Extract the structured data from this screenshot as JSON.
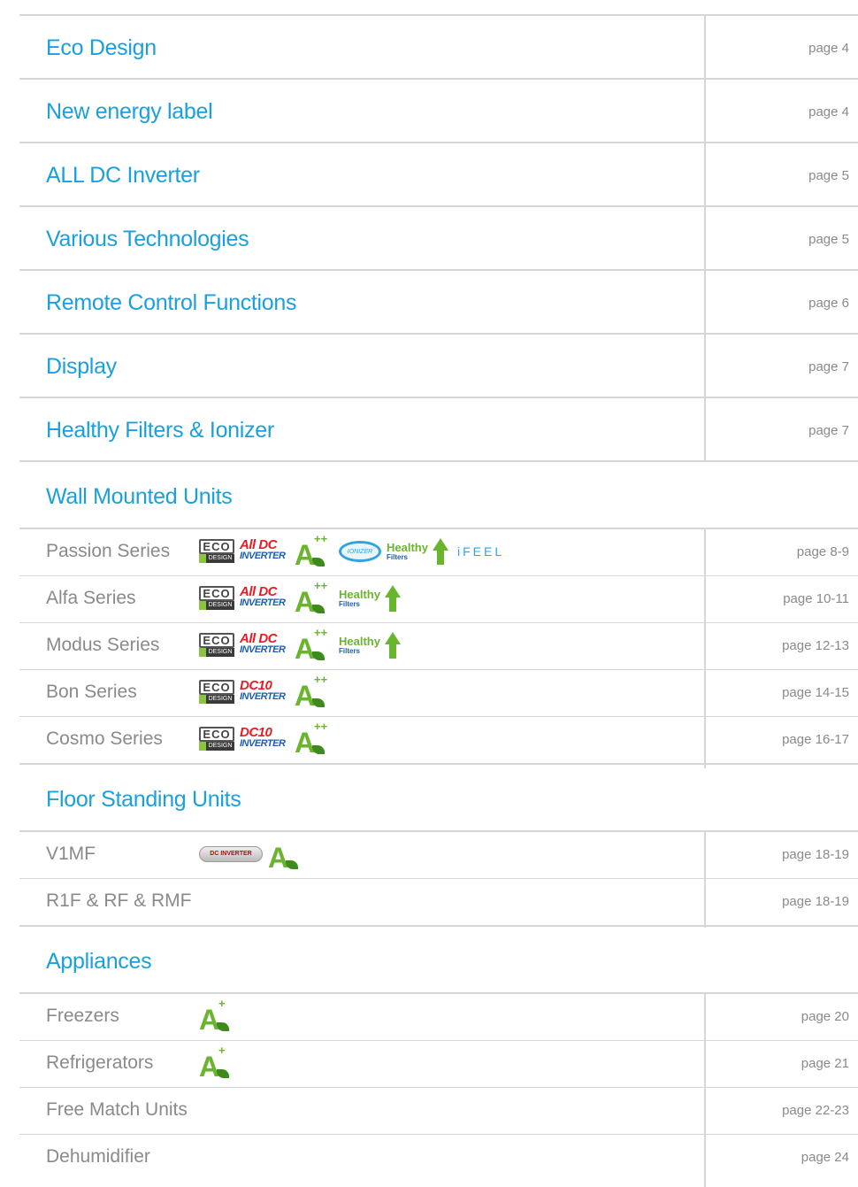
{
  "top_items": [
    {
      "title": "Eco Design",
      "page": "page  4"
    },
    {
      "title": "New energy label",
      "page": "page  4"
    },
    {
      "title": "ALL DC Inverter",
      "page": "page  5"
    },
    {
      "title": "Various Technologies",
      "page": "page  5"
    },
    {
      "title": "Remote Control Functions",
      "page": "page  6"
    },
    {
      "title": "Display",
      "page": "page  7"
    },
    {
      "title": "Healthy Filters & Ionizer",
      "page": "page  7"
    }
  ],
  "sections": [
    {
      "title": "Wall Mounted Units",
      "rows": [
        {
          "label": "Passion Series",
          "page": "page 8-9",
          "icons": [
            "eco-design-icon",
            "all-dc-inverter-icon",
            "a-plus-plus-icon",
            "ionizer-icon",
            "healthy-filters-icon",
            "ifeel-icon"
          ]
        },
        {
          "label": "Alfa Series",
          "page": "page 10-11",
          "icons": [
            "eco-design-icon",
            "all-dc-inverter-icon",
            "a-plus-plus-icon",
            "healthy-filters-icon"
          ]
        },
        {
          "label": "Modus Series",
          "page": "page 12-13",
          "icons": [
            "eco-design-icon",
            "all-dc-inverter-icon",
            "a-plus-plus-icon",
            "healthy-filters-icon"
          ]
        },
        {
          "label": "Bon Series",
          "page": "page 14-15",
          "icons": [
            "eco-design-icon",
            "dc10-inverter-icon",
            "a-plus-plus-icon"
          ]
        },
        {
          "label": "Cosmo Series",
          "page": "page 16-17",
          "icons": [
            "eco-design-icon",
            "dc10-inverter-icon",
            "a-plus-plus-icon"
          ]
        }
      ]
    },
    {
      "title": "Floor Standing Units",
      "rows": [
        {
          "label": "V1MF",
          "page": "page 18-19",
          "icons": [
            "dc-inverter-badge-icon",
            "a-class-icon"
          ]
        },
        {
          "label": "R1F & RF & RMF",
          "page": "page 18-19",
          "icons": []
        }
      ]
    },
    {
      "title": "Appliances",
      "rows": [
        {
          "label": "Freezers",
          "page": "page 20",
          "icons": [
            "a-plus-icon"
          ]
        },
        {
          "label": "Refrigerators",
          "page": "page 21",
          "icons": [
            "a-plus-icon"
          ]
        },
        {
          "label": "Free Match Units",
          "page": "page 22-23",
          "icons": []
        },
        {
          "label": "Dehumidifier",
          "page": "page 24",
          "icons": []
        }
      ]
    }
  ],
  "badges": {
    "eco_top": "ECO",
    "eco_bottom": "DESIGN",
    "alldc_top": "All DC",
    "alldc_bottom": "INVERTER",
    "dc10_top": "DC10",
    "dc10_bottom": "INVERTER",
    "a_letter": "A",
    "a_plusplus": "++",
    "a_plus": "+",
    "ionizer": "IONIZER",
    "healthy": "Healthy",
    "filters": "Filters",
    "ifeel": "iFEEL",
    "dc_inverter": "DC INVERTER"
  },
  "colors": {
    "accent": "#1aa0dc",
    "text_gray": "#8a8a8a",
    "rule": "#d6d6d6",
    "green": "#69b52e"
  }
}
